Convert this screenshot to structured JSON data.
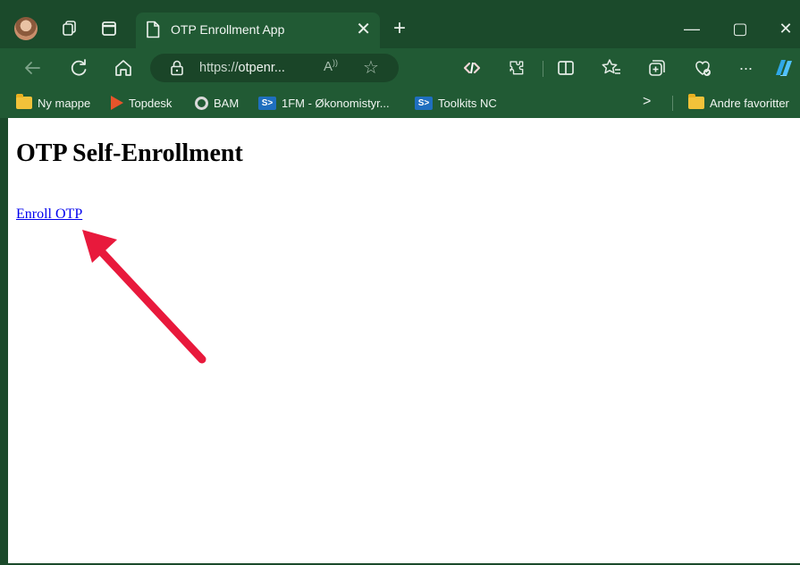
{
  "browser": {
    "tab": {
      "title": "OTP Enrollment App",
      "close_glyph": "✕"
    },
    "new_tab_glyph": "+",
    "window_controls": {
      "minimize": "—",
      "maximize": "▢",
      "close": "✕"
    },
    "address": {
      "scheme": "https://",
      "host": "otpenr..."
    },
    "more_glyph": "···",
    "favorites": [
      {
        "label": "Ny mappe",
        "icon": "folder-icon"
      },
      {
        "label": "Topdesk",
        "icon": "topdesk-icon"
      },
      {
        "label": "BAM",
        "icon": "bam-icon"
      },
      {
        "label": "1FM - Økonomistyr...",
        "icon": "sharepoint-icon"
      },
      {
        "label": "Toolkits NC",
        "icon": "sharepoint-icon"
      },
      {
        "label": "Andre favoritter",
        "icon": "folder-icon"
      }
    ]
  },
  "page": {
    "title": "OTP Self-Enrollment",
    "enroll_link": "Enroll OTP"
  },
  "annotation": {
    "arrow_color": "#e8193c",
    "target": "enroll-link"
  },
  "colors": {
    "chrome_dark": "#1b4a2b",
    "chrome": "#215a34",
    "link": "#0000ee"
  }
}
